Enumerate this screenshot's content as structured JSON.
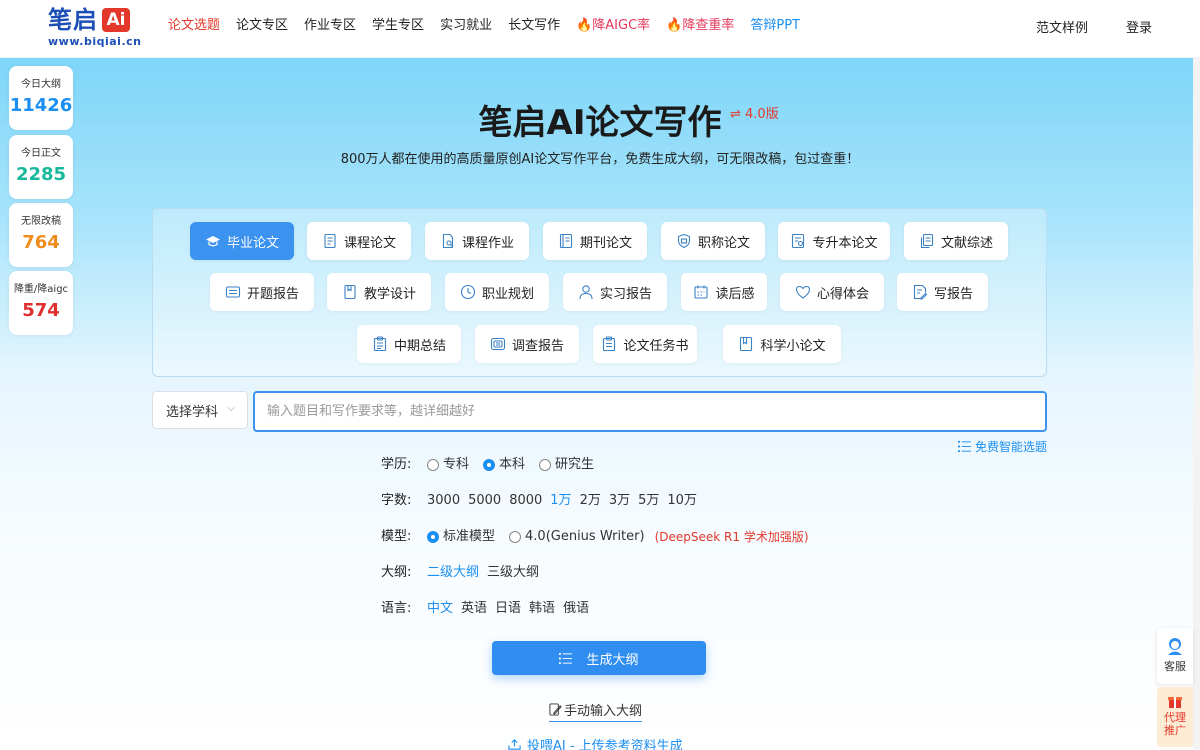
{
  "brand": {
    "name_cn": "笔启",
    "ai": "Ai",
    "url": "www.biqiai.cn"
  },
  "nav": {
    "links": [
      {
        "label": "论文选题",
        "style": "active"
      },
      {
        "label": "论文专区",
        "style": ""
      },
      {
        "label": "作业专区",
        "style": ""
      },
      {
        "label": "学生专区",
        "style": ""
      },
      {
        "label": "实习就业",
        "style": ""
      },
      {
        "label": "长文写作",
        "style": ""
      },
      {
        "label": "🔥降AIGC率",
        "style": "hot"
      },
      {
        "label": "🔥降查重率",
        "style": "hot"
      },
      {
        "label": "答辩PPT",
        "style": "blue"
      }
    ],
    "samples": "范文样例",
    "login": "登录"
  },
  "stats": [
    {
      "label": "今日大纲",
      "value": "11426",
      "color": "#1b8ff0"
    },
    {
      "label": "今日正文",
      "value": "2285",
      "color": "#17b89c"
    },
    {
      "label": "无限改稿",
      "value": "764",
      "color": "#f08c1e"
    },
    {
      "label": "降重/降aigc",
      "value": "574",
      "color": "#e02d2d"
    }
  ],
  "hero": {
    "title": "笔启AI论文写作",
    "version": "⇌ 4.0版",
    "subtitle": "800万人都在使用的高质量原创AI论文写作平台，免费生成大纲，可无限改稿，包过查重！"
  },
  "types": [
    {
      "label": "毕业论文",
      "icon": "graduation-cap-icon",
      "active": true
    },
    {
      "label": "课程论文",
      "icon": "document-icon"
    },
    {
      "label": "课程作业",
      "icon": "document-search-icon"
    },
    {
      "label": "期刊论文",
      "icon": "journal-icon"
    },
    {
      "label": "职称论文",
      "icon": "badge-icon"
    },
    {
      "label": "专升本论文",
      "icon": "document-check-icon"
    },
    {
      "label": "文献综述",
      "icon": "copy-icon"
    },
    {
      "label": "开题报告",
      "icon": "report-icon"
    },
    {
      "label": "教学设计",
      "icon": "book-icon"
    },
    {
      "label": "职业规划",
      "icon": "clock-icon"
    },
    {
      "label": "实习报告",
      "icon": "user-icon"
    },
    {
      "label": "读后感",
      "icon": "calendar-icon"
    },
    {
      "label": "心得体会",
      "icon": "heart-icon"
    },
    {
      "label": "写报告",
      "icon": "document-edit-icon"
    },
    {
      "label": "中期总结",
      "icon": "clipboard-icon"
    },
    {
      "label": "调查报告",
      "icon": "survey-icon"
    },
    {
      "label": "论文任务书",
      "icon": "task-icon"
    },
    {
      "label": "科学小论文",
      "icon": "book-open-icon"
    }
  ],
  "form": {
    "subject_select": "选择学科",
    "topic_placeholder": "输入题目和写作要求等，越详细越好",
    "smart_topic": "免费智能选题",
    "education": {
      "label": "学历:",
      "options": [
        "专科",
        "本科",
        "研究生"
      ],
      "selected": "本科"
    },
    "word_count": {
      "label": "字数:",
      "options": [
        "3000",
        "5000",
        "8000",
        "1万",
        "2万",
        "3万",
        "5万",
        "10万"
      ],
      "selected": "1万"
    },
    "model": {
      "label": "模型:",
      "options": [
        "标准模型",
        "4.0(Genius Writer)"
      ],
      "selected": "标准模型",
      "note": "(DeepSeek R1 学术加强版)"
    },
    "outline": {
      "label": "大纲:",
      "options": [
        "二级大纲",
        "三级大纲"
      ],
      "selected": "二级大纲"
    },
    "language": {
      "label": "语言:",
      "options": [
        "中文",
        "英语",
        "日语",
        "韩语",
        "俄语"
      ],
      "selected": "中文"
    },
    "generate": "生成大纲",
    "manual": "手动输入大纲",
    "upload": "投喂AI - 上传参考资料生成"
  },
  "float": {
    "cs": "客服",
    "agent_line1": "代理",
    "agent_line2": "推广"
  }
}
